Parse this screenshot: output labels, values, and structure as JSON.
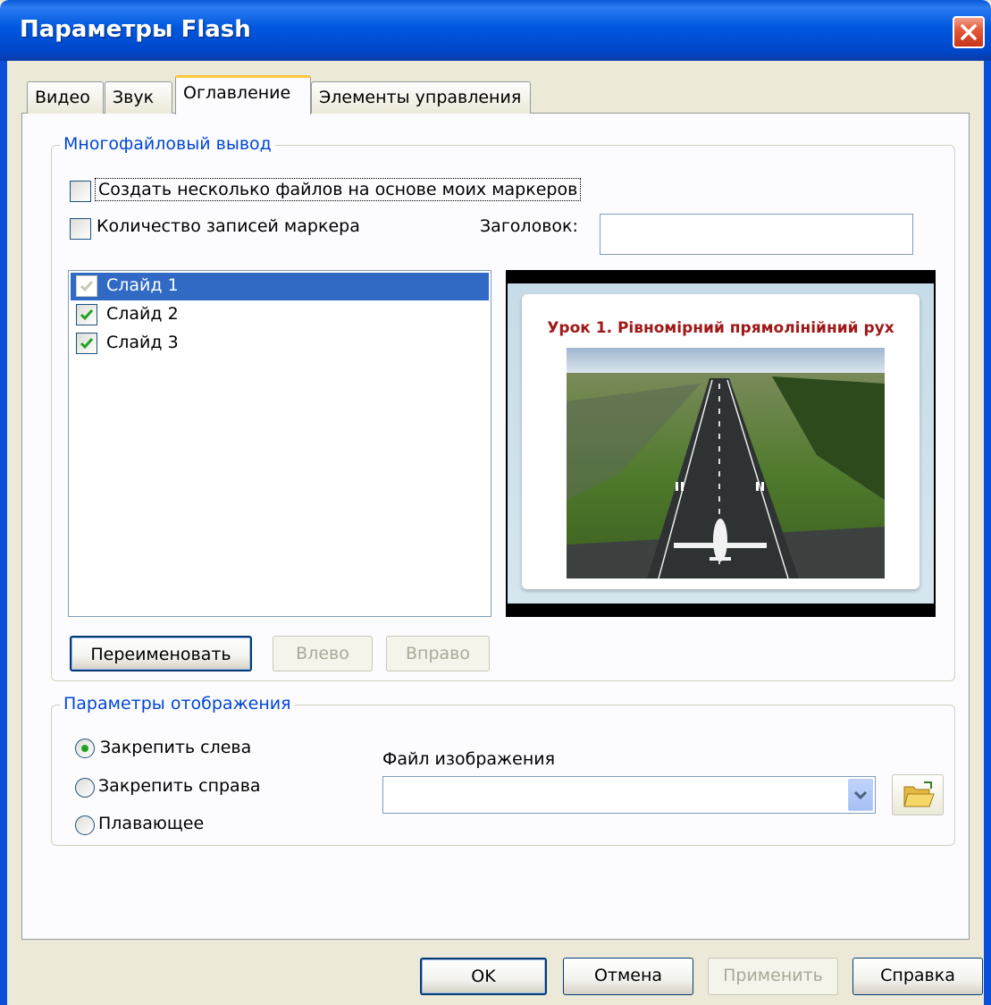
{
  "window": {
    "title": "Параметры Flash"
  },
  "tabs": [
    {
      "label": "Видео"
    },
    {
      "label": "Звук"
    },
    {
      "label": "Оглавление",
      "active": true
    },
    {
      "label": "Элементы управления"
    }
  ],
  "multifile": {
    "group_title": "Многофайловый вывод",
    "create_files_label": "Создать несколько файлов на основе моих маркеров",
    "create_files_checked": false,
    "marker_count_label": "Количество записей маркера",
    "marker_count_checked": false,
    "heading_label": "Заголовок:",
    "heading_value": "",
    "slides": [
      {
        "label": "Слайд 1",
        "checked": true,
        "selected": true,
        "check_disabled": true
      },
      {
        "label": "Слайд 2",
        "checked": true,
        "selected": false
      },
      {
        "label": "Слайд 3",
        "checked": true,
        "selected": false
      }
    ],
    "preview_title": "Урок 1. Рівномірний прямолінійний рух",
    "rename_button": "Переименовать",
    "left_button": "Влево",
    "right_button": "Вправо"
  },
  "display": {
    "group_title": "Параметры отображения",
    "options": [
      {
        "label": "Закрепить слева",
        "selected": true
      },
      {
        "label": "Закрепить справа",
        "selected": false
      },
      {
        "label": "Плавающее",
        "selected": false
      }
    ],
    "image_file_label": "Файл изображения",
    "image_file_value": ""
  },
  "footer": {
    "ok": "OK",
    "cancel": "Отмена",
    "apply": "Применить",
    "help": "Справка"
  },
  "colors": {
    "titlebar": "#0058e0",
    "group_title": "#0046d5",
    "selection": "#316ac5",
    "check_green": "#21a121",
    "slide_title": "#a01818"
  }
}
